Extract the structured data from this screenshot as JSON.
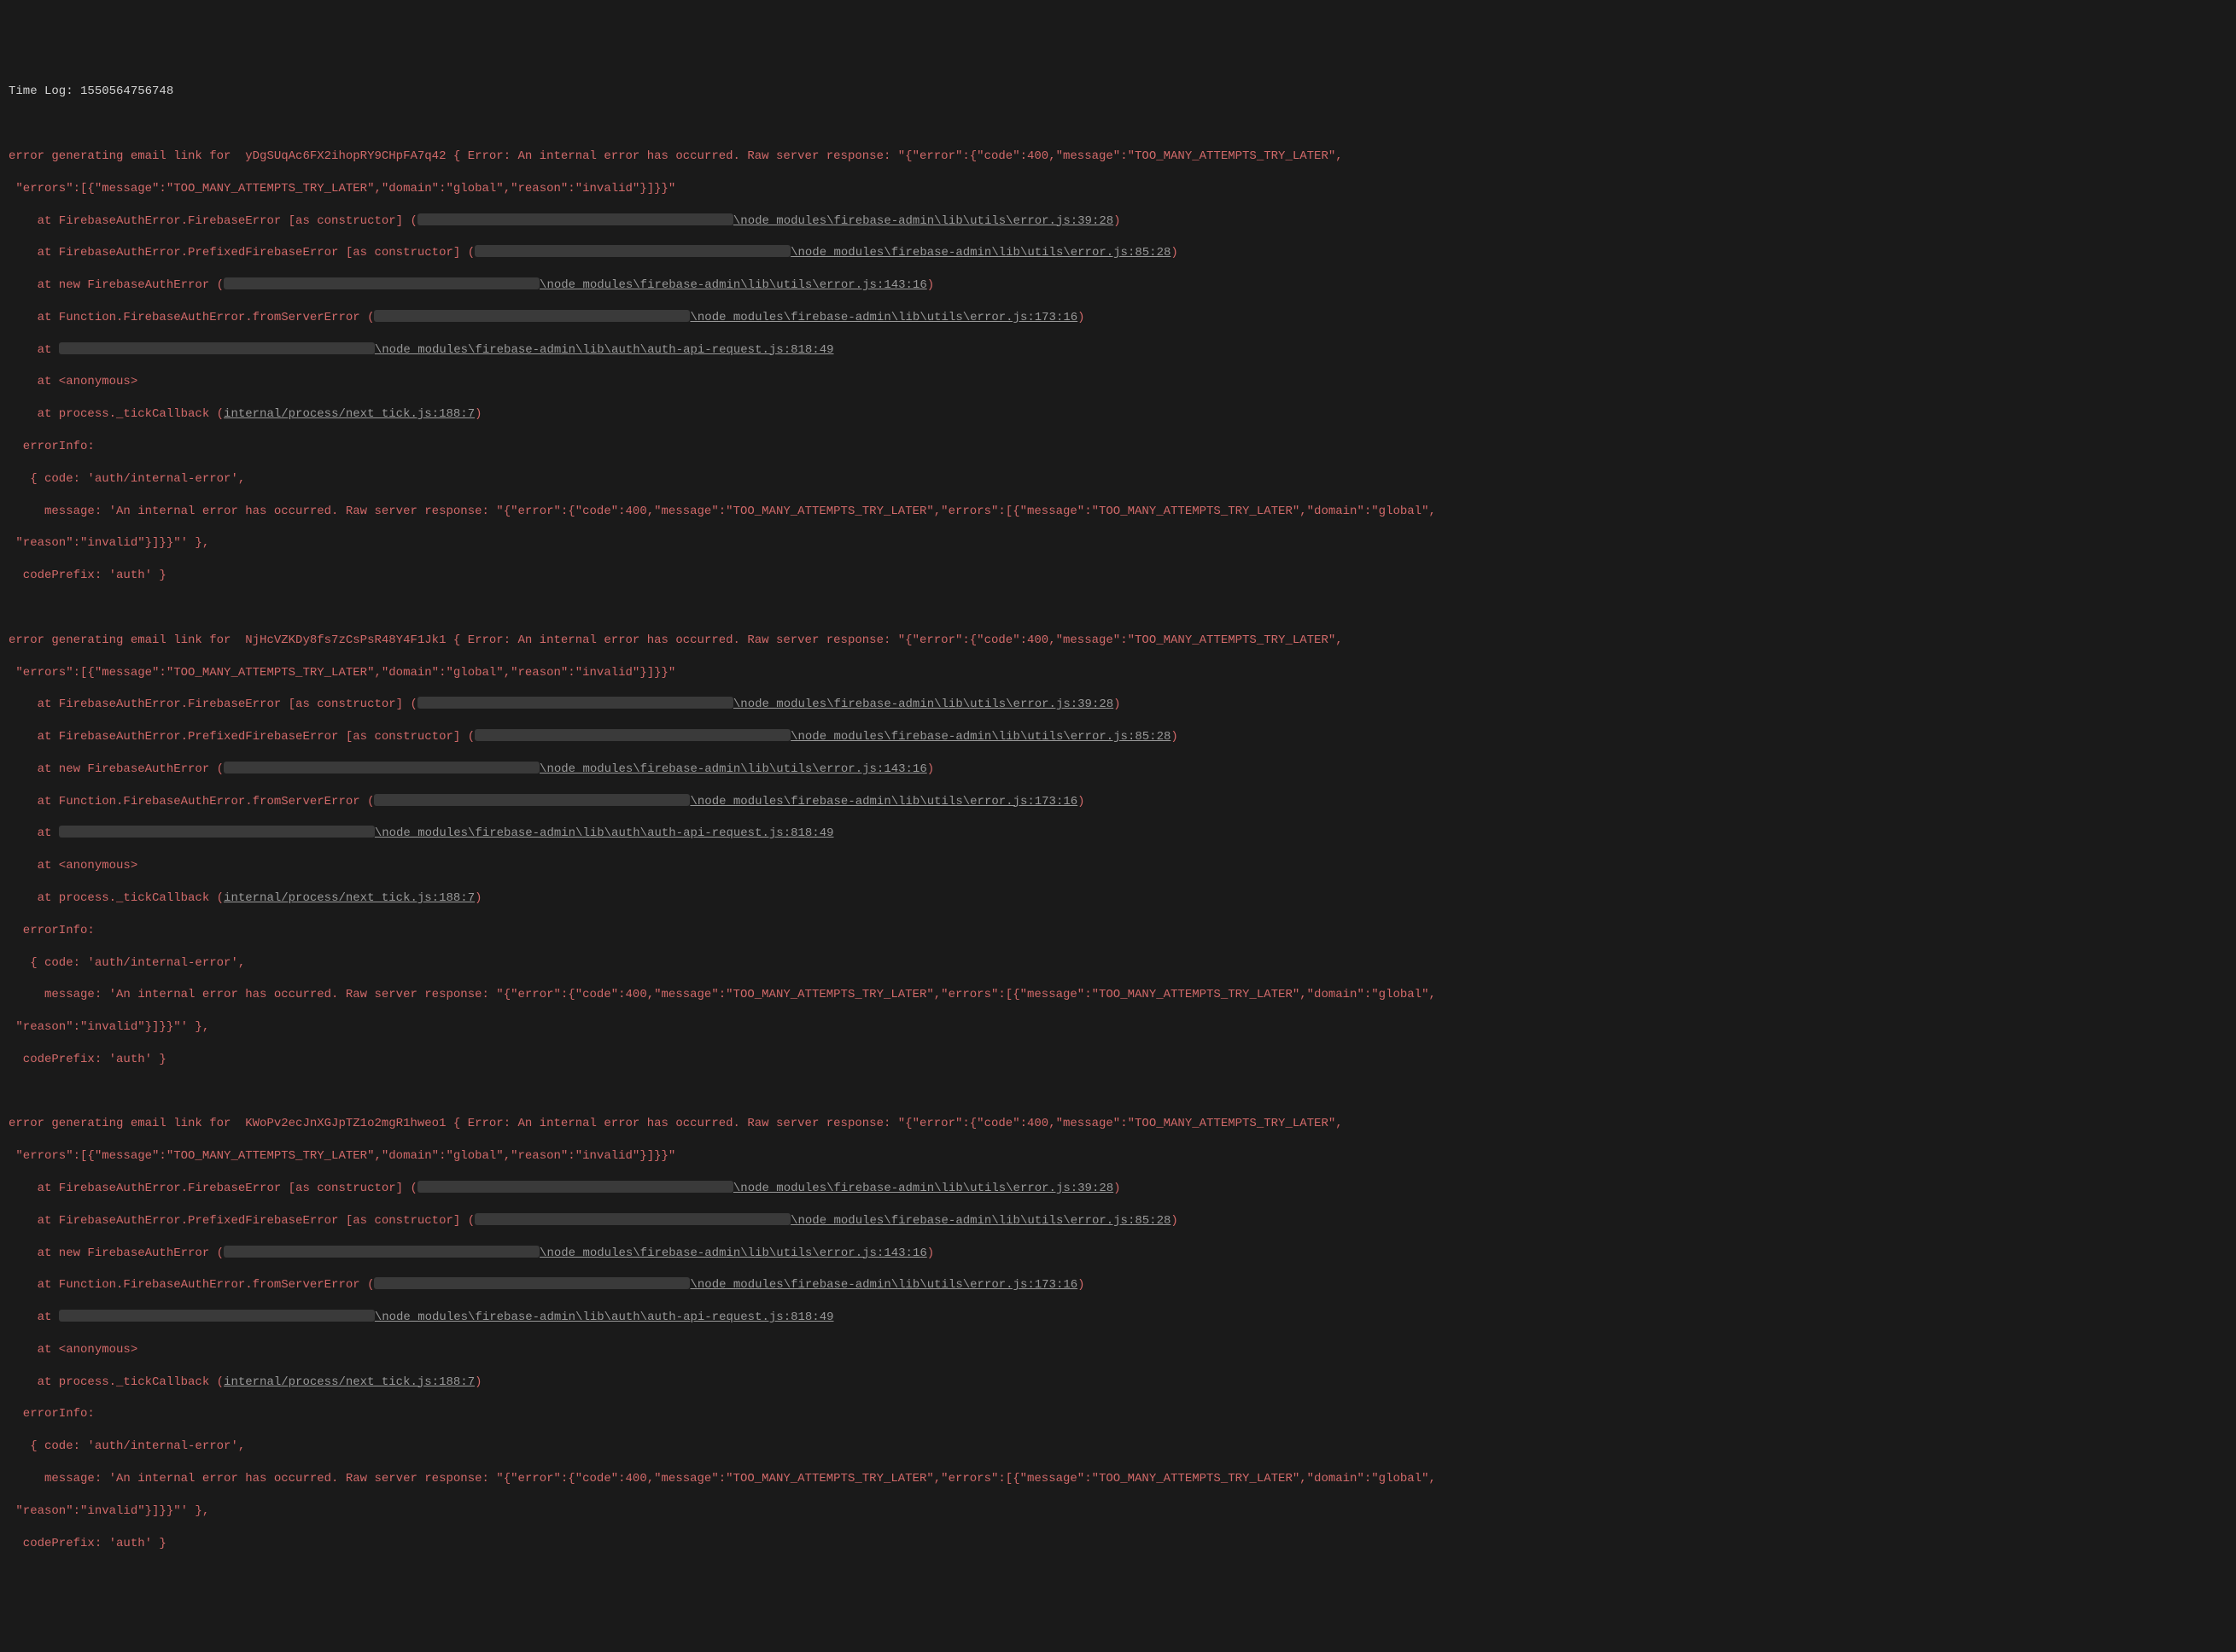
{
  "timelog": "Time Log: 1550564756748",
  "errors": [
    {
      "id": "yDgSUqAc6FX2ihopRY9CHpFA7q42",
      "header1": "error generating email link for  yDgSUqAc6FX2ihopRY9CHpFA7q42 { Error: An internal error has occurred. Raw server response: \"{\"error\":{\"code\":400,\"message\":\"TOO_MANY_ATTEMPTS_TRY_LATER\",",
      "header2": " \"errors\":[{\"message\":\"TOO_MANY_ATTEMPTS_TRY_LATER\",\"domain\":\"global\",\"reason\":\"invalid\"}]}}\"",
      "stack": {
        "l1_pre": "    at FirebaseAuthError.FirebaseError [as constructor] (",
        "l1_path": "\\node_modules\\firebase-admin\\lib\\utils\\error.js:39:28",
        "l1_post": ")",
        "l2_pre": "    at FirebaseAuthError.PrefixedFirebaseError [as constructor] (",
        "l2_path": "\\node_modules\\firebase-admin\\lib\\utils\\error.js:85:28",
        "l2_post": ")",
        "l3_pre": "    at new FirebaseAuthError (",
        "l3_path": "\\node_modules\\firebase-admin\\lib\\utils\\error.js:143:16",
        "l3_post": ")",
        "l4_pre": "    at Function.FirebaseAuthError.fromServerError (",
        "l4_path": "\\node_modules\\firebase-admin\\lib\\utils\\error.js:173:16",
        "l4_post": ")",
        "l5_pre": "    at ",
        "l5_path": "\\node_modules\\firebase-admin\\lib\\auth\\auth-api-request.js:818:49",
        "l6": "    at <anonymous>",
        "l7_pre": "    at process._tickCallback (",
        "l7_path": "internal/process/next_tick.js:188:7",
        "l7_post": ")"
      },
      "info": {
        "h": "  errorInfo:",
        "code": "   { code: 'auth/internal-error',",
        "msg": "     message: 'An internal error has occurred. Raw server response: \"{\"error\":{\"code\":400,\"message\":\"TOO_MANY_ATTEMPTS_TRY_LATER\",\"errors\":[{\"message\":\"TOO_MANY_ATTEMPTS_TRY_LATER\",\"domain\":\"global\",",
        "msg2": " \"reason\":\"invalid\"}]}}\"' },",
        "prefix": "  codePrefix: 'auth' }"
      }
    },
    {
      "id": "NjHcVZKDy8fs7zCsPsR48Y4F1Jk1",
      "header1": "error generating email link for  NjHcVZKDy8fs7zCsPsR48Y4F1Jk1 { Error: An internal error has occurred. Raw server response: \"{\"error\":{\"code\":400,\"message\":\"TOO_MANY_ATTEMPTS_TRY_LATER\",",
      "header2": " \"errors\":[{\"message\":\"TOO_MANY_ATTEMPTS_TRY_LATER\",\"domain\":\"global\",\"reason\":\"invalid\"}]}}\"",
      "stack": {
        "l1_pre": "    at FirebaseAuthError.FirebaseError [as constructor] (",
        "l1_path": "\\node_modules\\firebase-admin\\lib\\utils\\error.js:39:28",
        "l1_post": ")",
        "l2_pre": "    at FirebaseAuthError.PrefixedFirebaseError [as constructor] (",
        "l2_path": "\\node_modules\\firebase-admin\\lib\\utils\\error.js:85:28",
        "l2_post": ")",
        "l3_pre": "    at new FirebaseAuthError (",
        "l3_path": "\\node_modules\\firebase-admin\\lib\\utils\\error.js:143:16",
        "l3_post": ")",
        "l4_pre": "    at Function.FirebaseAuthError.fromServerError (",
        "l4_path": "\\node_modules\\firebase-admin\\lib\\utils\\error.js:173:16",
        "l4_post": ")",
        "l5_pre": "    at ",
        "l5_path": "\\node_modules\\firebase-admin\\lib\\auth\\auth-api-request.js:818:49",
        "l6": "    at <anonymous>",
        "l7_pre": "    at process._tickCallback (",
        "l7_path": "internal/process/next_tick.js:188:7",
        "l7_post": ")"
      },
      "info": {
        "h": "  errorInfo:",
        "code": "   { code: 'auth/internal-error',",
        "msg": "     message: 'An internal error has occurred. Raw server response: \"{\"error\":{\"code\":400,\"message\":\"TOO_MANY_ATTEMPTS_TRY_LATER\",\"errors\":[{\"message\":\"TOO_MANY_ATTEMPTS_TRY_LATER\",\"domain\":\"global\",",
        "msg2": " \"reason\":\"invalid\"}]}}\"' },",
        "prefix": "  codePrefix: 'auth' }"
      }
    },
    {
      "id": "KWoPv2ecJnXGJpTZ1o2mgR1hweo1",
      "header1": "error generating email link for  KWoPv2ecJnXGJpTZ1o2mgR1hweo1 { Error: An internal error has occurred. Raw server response: \"{\"error\":{\"code\":400,\"message\":\"TOO_MANY_ATTEMPTS_TRY_LATER\",",
      "header2": " \"errors\":[{\"message\":\"TOO_MANY_ATTEMPTS_TRY_LATER\",\"domain\":\"global\",\"reason\":\"invalid\"}]}}\"",
      "stack": {
        "l1_pre": "    at FirebaseAuthError.FirebaseError [as constructor] (",
        "l1_path": "\\node_modules\\firebase-admin\\lib\\utils\\error.js:39:28",
        "l1_post": ")",
        "l2_pre": "    at FirebaseAuthError.PrefixedFirebaseError [as constructor] (",
        "l2_path": "\\node_modules\\firebase-admin\\lib\\utils\\error.js:85:28",
        "l2_post": ")",
        "l3_pre": "    at new FirebaseAuthError (",
        "l3_path": "\\node_modules\\firebase-admin\\lib\\utils\\error.js:143:16",
        "l3_post": ")",
        "l4_pre": "    at Function.FirebaseAuthError.fromServerError (",
        "l4_path": "\\node_modules\\firebase-admin\\lib\\utils\\error.js:173:16",
        "l4_post": ")",
        "l5_pre": "    at ",
        "l5_path": "\\node_modules\\firebase-admin\\lib\\auth\\auth-api-request.js:818:49",
        "l6": "    at <anonymous>",
        "l7_pre": "    at process._tickCallback (",
        "l7_path": "internal/process/next_tick.js:188:7",
        "l7_post": ")"
      },
      "info": {
        "h": "  errorInfo:",
        "code": "   { code: 'auth/internal-error',",
        "msg": "     message: 'An internal error has occurred. Raw server response: \"{\"error\":{\"code\":400,\"message\":\"TOO_MANY_ATTEMPTS_TRY_LATER\",\"errors\":[{\"message\":\"TOO_MANY_ATTEMPTS_TRY_LATER\",\"domain\":\"global\",",
        "msg2": " \"reason\":\"invalid\"}]}}\"' },",
        "prefix": "  codePrefix: 'auth' }"
      }
    }
  ],
  "redact_widths": {
    "r1": 370,
    "r2": 370,
    "r3": 370,
    "r4": 370,
    "r5": 370
  }
}
